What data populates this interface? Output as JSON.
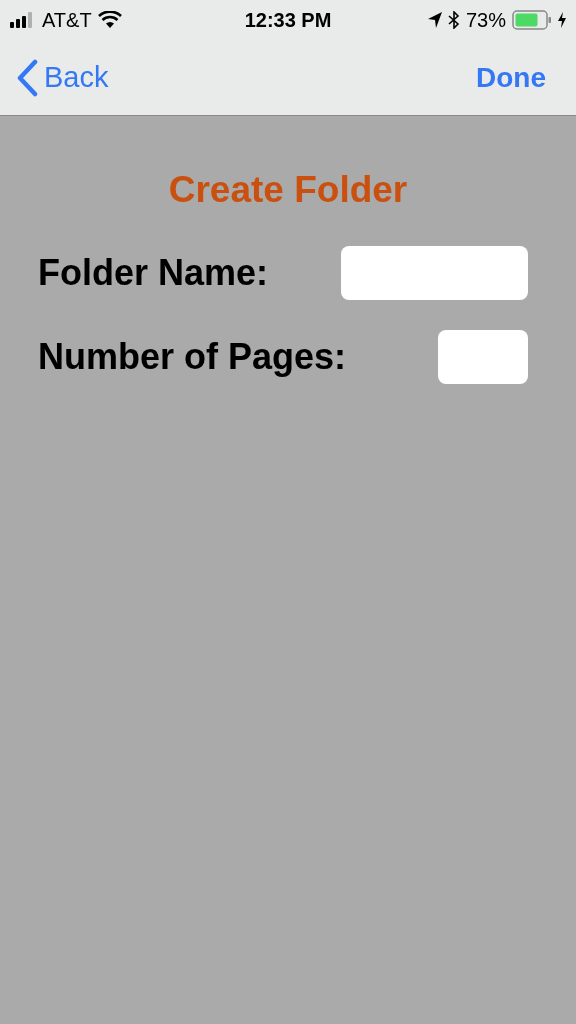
{
  "status_bar": {
    "carrier": "AT&T",
    "time": "12:33 PM",
    "battery": "73%"
  },
  "nav_bar": {
    "back": "Back",
    "done": "Done"
  },
  "title": "Create Folder",
  "fields": [
    {
      "label": "Folder Name:",
      "kind": "wide"
    },
    {
      "label": "Number of Pages:",
      "kind": "narrow"
    }
  ]
}
